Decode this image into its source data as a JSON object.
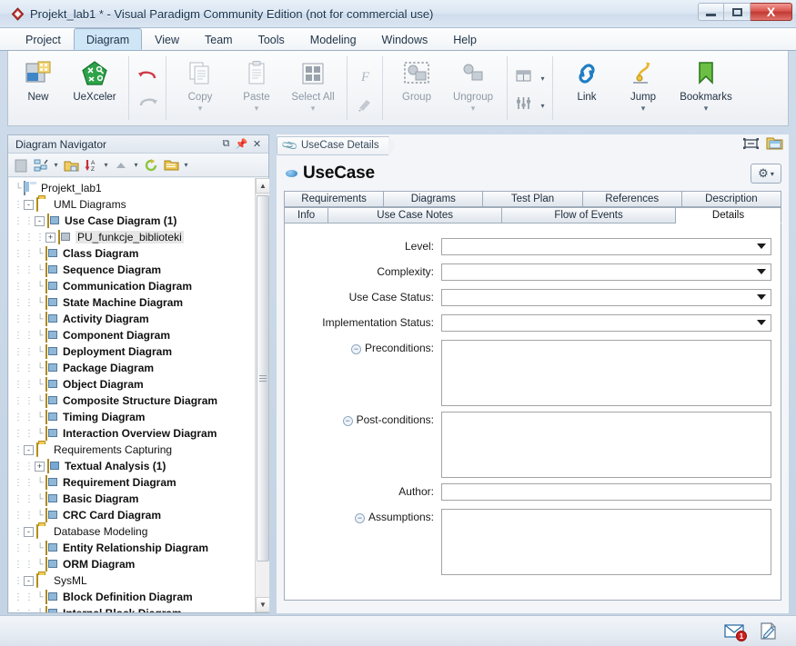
{
  "window": {
    "title": "Projekt_lab1 * - Visual Paradigm Community Edition (not for commercial use)",
    "app_icon": "diamond-logo-icon",
    "minimize_label": "Minimize",
    "maximize_label": "Maximize",
    "close_label": "X"
  },
  "menubar": {
    "items": [
      {
        "label": "Project",
        "active": false
      },
      {
        "label": "Diagram",
        "active": true
      },
      {
        "label": "View",
        "active": false
      },
      {
        "label": "Team",
        "active": false
      },
      {
        "label": "Tools",
        "active": false
      },
      {
        "label": "Modeling",
        "active": false
      },
      {
        "label": "Windows",
        "active": false
      },
      {
        "label": "Help",
        "active": false
      }
    ]
  },
  "ribbon": {
    "groups": [
      {
        "buttons": [
          {
            "label": "New",
            "icon": "new-diagram-icon",
            "caret": false,
            "disabled": false
          },
          {
            "label": "UeXceler",
            "icon": "uexceler-icon",
            "caret": false,
            "disabled": false
          }
        ]
      },
      {
        "buttons": [
          {
            "label": "",
            "icon": "undo-icon",
            "caret": false,
            "disabled": false
          },
          {
            "label": "",
            "icon": "redo-icon",
            "caret": false,
            "disabled": true
          }
        ]
      },
      {
        "buttons": [
          {
            "label": "Copy",
            "icon": "copy-icon",
            "caret": true,
            "disabled": true
          },
          {
            "label": "Paste",
            "icon": "paste-icon",
            "caret": true,
            "disabled": true
          },
          {
            "label": "Select All",
            "icon": "select-all-icon",
            "caret": true,
            "disabled": true
          }
        ]
      },
      {
        "buttons": [
          {
            "label": "",
            "icon": "format-painter-f-icon",
            "caret": false,
            "disabled": true
          },
          {
            "label": "",
            "icon": "format-brush-icon",
            "caret": false,
            "disabled": true
          }
        ]
      },
      {
        "buttons": [
          {
            "label": "Group",
            "icon": "group-icon",
            "caret": false,
            "disabled": true
          },
          {
            "label": "Ungroup",
            "icon": "ungroup-icon",
            "caret": true,
            "disabled": true
          }
        ]
      },
      {
        "buttons": [
          {
            "label": "",
            "icon": "align-layout-icon",
            "caret": true,
            "disabled": true
          },
          {
            "label": "",
            "icon": "distribute-icon",
            "caret": true,
            "disabled": true
          }
        ]
      },
      {
        "buttons": [
          {
            "label": "Link",
            "icon": "link-chain-icon",
            "caret": false,
            "disabled": false
          },
          {
            "label": "Jump",
            "icon": "jump-arrow-icon",
            "caret": true,
            "disabled": false
          },
          {
            "label": "Bookmarks",
            "icon": "bookmark-flag-icon",
            "caret": true,
            "disabled": false
          }
        ]
      }
    ]
  },
  "navigator": {
    "title": "Diagram Navigator",
    "header_icons": [
      "restore-icon",
      "pin-icon",
      "close-icon"
    ],
    "toolbar_icons": [
      "blank-page-icon",
      "diagram-hierarchy-icon",
      "dropdown-caret-1",
      "open-folder-icon",
      "sort-az-icon",
      "dropdown-caret-2",
      "collapse-up-icon",
      "dropdown-caret-3",
      "refresh-icon",
      "folder-view-icon",
      "dropdown-caret-4"
    ],
    "scrollbar": {
      "up_arrow": "▲",
      "down_arrow": "▼"
    },
    "tree": [
      {
        "label": "Projekt_lab1",
        "indent": 0,
        "expander": "",
        "icon": "project-icon",
        "bold": false,
        "selected": false
      },
      {
        "label": "UML Diagrams",
        "indent": 1,
        "expander": "-",
        "icon": "folder-icon",
        "bold": false,
        "selected": false
      },
      {
        "label": "Use Case Diagram (1)",
        "indent": 2,
        "expander": "-",
        "icon": "use-case-diagram-icon",
        "bold": true,
        "selected": false
      },
      {
        "label": "PU_funkcje_biblioteki",
        "indent": 3,
        "expander": "+",
        "icon": "diagram-file-icon",
        "bold": false,
        "selected": true
      },
      {
        "label": "Class Diagram",
        "indent": 2,
        "expander": "",
        "icon": "class-diagram-icon",
        "bold": true,
        "selected": false
      },
      {
        "label": "Sequence Diagram",
        "indent": 2,
        "expander": "",
        "icon": "sequence-diagram-icon",
        "bold": true,
        "selected": false
      },
      {
        "label": "Communication Diagram",
        "indent": 2,
        "expander": "",
        "icon": "communication-diagram-icon",
        "bold": true,
        "selected": false
      },
      {
        "label": "State Machine Diagram",
        "indent": 2,
        "expander": "",
        "icon": "state-machine-diagram-icon",
        "bold": true,
        "selected": false
      },
      {
        "label": "Activity Diagram",
        "indent": 2,
        "expander": "",
        "icon": "activity-diagram-icon",
        "bold": true,
        "selected": false
      },
      {
        "label": "Component Diagram",
        "indent": 2,
        "expander": "",
        "icon": "component-diagram-icon",
        "bold": true,
        "selected": false
      },
      {
        "label": "Deployment Diagram",
        "indent": 2,
        "expander": "",
        "icon": "deployment-diagram-icon",
        "bold": true,
        "selected": false
      },
      {
        "label": "Package Diagram",
        "indent": 2,
        "expander": "",
        "icon": "package-diagram-icon",
        "bold": true,
        "selected": false
      },
      {
        "label": "Object Diagram",
        "indent": 2,
        "expander": "",
        "icon": "object-diagram-icon",
        "bold": true,
        "selected": false
      },
      {
        "label": "Composite Structure Diagram",
        "indent": 2,
        "expander": "",
        "icon": "composite-structure-diagram-icon",
        "bold": true,
        "selected": false
      },
      {
        "label": "Timing Diagram",
        "indent": 2,
        "expander": "",
        "icon": "timing-diagram-icon",
        "bold": true,
        "selected": false
      },
      {
        "label": "Interaction Overview Diagram",
        "indent": 2,
        "expander": "",
        "icon": "interaction-overview-diagram-icon",
        "bold": true,
        "selected": false
      },
      {
        "label": "Requirements Capturing",
        "indent": 1,
        "expander": "-",
        "icon": "folder-icon",
        "bold": false,
        "selected": false
      },
      {
        "label": "Textual Analysis (1)",
        "indent": 2,
        "expander": "+",
        "icon": "textual-analysis-icon",
        "bold": true,
        "selected": false
      },
      {
        "label": "Requirement Diagram",
        "indent": 2,
        "expander": "",
        "icon": "requirement-diagram-icon",
        "bold": true,
        "selected": false
      },
      {
        "label": "Basic Diagram",
        "indent": 2,
        "expander": "",
        "icon": "basic-diagram-icon",
        "bold": true,
        "selected": false
      },
      {
        "label": "CRC Card Diagram",
        "indent": 2,
        "expander": "",
        "icon": "crc-card-diagram-icon",
        "bold": true,
        "selected": false
      },
      {
        "label": "Database Modeling",
        "indent": 1,
        "expander": "-",
        "icon": "folder-icon",
        "bold": false,
        "selected": false
      },
      {
        "label": "Entity Relationship Diagram",
        "indent": 2,
        "expander": "",
        "icon": "erd-icon",
        "bold": true,
        "selected": false
      },
      {
        "label": "ORM Diagram",
        "indent": 2,
        "expander": "",
        "icon": "orm-diagram-icon",
        "bold": true,
        "selected": false
      },
      {
        "label": "SysML",
        "indent": 1,
        "expander": "-",
        "icon": "folder-icon",
        "bold": false,
        "selected": false
      },
      {
        "label": "Block Definition Diagram",
        "indent": 2,
        "expander": "",
        "icon": "block-definition-diagram-icon",
        "bold": true,
        "selected": false
      },
      {
        "label": "Internal Block Diagram",
        "indent": 2,
        "expander": "",
        "icon": "internal-block-diagram-icon",
        "bold": true,
        "selected": false
      }
    ]
  },
  "editor": {
    "doc_tab": {
      "label": "UseCase Details",
      "icon": "paperclip-icon"
    },
    "doc_icons": [
      "fit-window-icon",
      "open-specification-icon"
    ],
    "entity": {
      "title": "UseCase",
      "icon": "use-case-oval-icon"
    },
    "options_button": {
      "icon": "gear-icon",
      "caret": "▾"
    },
    "tabs_row1": [
      {
        "label": "Requirements",
        "active": false
      },
      {
        "label": "Diagrams",
        "active": false
      },
      {
        "label": "Test Plan",
        "active": false
      },
      {
        "label": "References",
        "active": false
      },
      {
        "label": "Description",
        "active": false
      }
    ],
    "tabs_row2": [
      {
        "label": "Info",
        "active": false
      },
      {
        "label": "Use Case Notes",
        "active": false
      },
      {
        "label": "Flow of Events",
        "active": false
      },
      {
        "label": "Details",
        "active": true
      }
    ],
    "form": {
      "fields": [
        {
          "label": "Level:",
          "type": "combo",
          "value": "",
          "collapsible": false
        },
        {
          "label": "Complexity:",
          "type": "combo",
          "value": "",
          "collapsible": false
        },
        {
          "label": "Use Case Status:",
          "type": "combo",
          "value": "",
          "collapsible": false
        },
        {
          "label": "Implementation Status:",
          "type": "combo",
          "value": "",
          "collapsible": false
        },
        {
          "label": "Preconditions:",
          "type": "textarea",
          "value": "",
          "collapsible": true
        },
        {
          "label": "Post-conditions:",
          "type": "textarea",
          "value": "",
          "collapsible": true
        },
        {
          "label": "Author:",
          "type": "text",
          "value": "",
          "collapsible": false
        },
        {
          "label": "Assumptions:",
          "type": "textarea",
          "value": "",
          "collapsible": true
        }
      ]
    }
  },
  "statusbar": {
    "message_icon": "envelope-icon",
    "message_badge": "1",
    "note_icon": "edit-note-icon"
  },
  "colors": {
    "accent": "#cfe6f7",
    "title_text": "#16334d",
    "close_button": "#c13a33",
    "badge_red": "#cc1f1f",
    "selection_gray": "#e6e6e6"
  }
}
